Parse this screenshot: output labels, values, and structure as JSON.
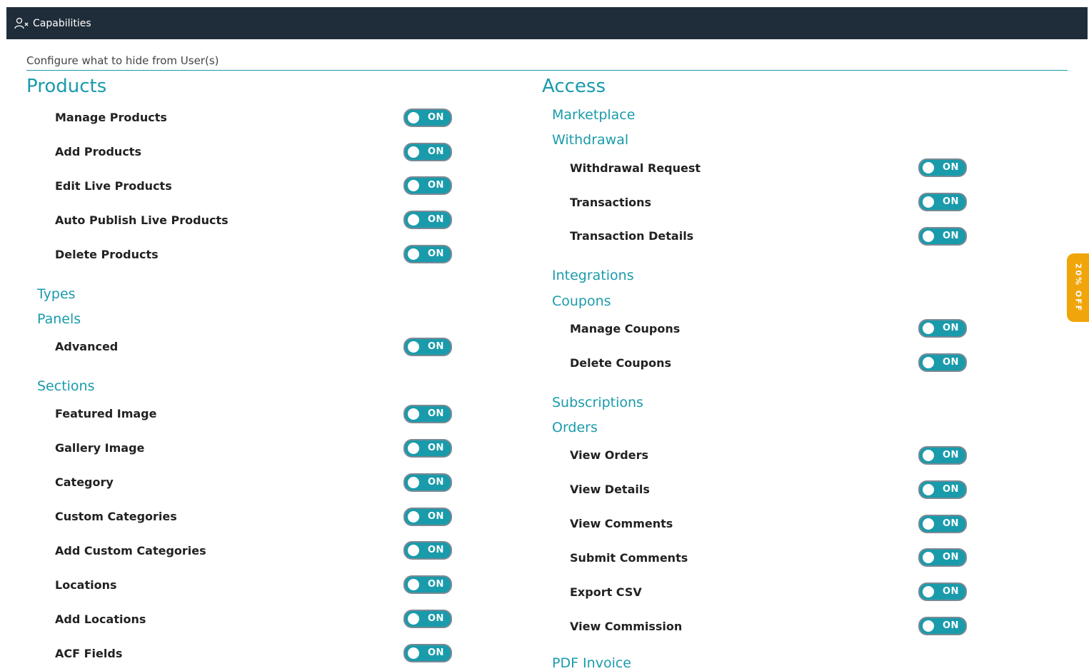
{
  "header": {
    "title": "Capabilities",
    "icon": "user-x-icon"
  },
  "subtitle": "Configure what to hide from User(s)",
  "toggle_label": "ON",
  "promo": "20% OFF",
  "left": {
    "title": "Products",
    "products": [
      "Manage Products",
      "Add Products",
      "Edit Live Products",
      "Auto Publish Live Products",
      "Delete Products"
    ],
    "types": "Types",
    "panels": "Panels",
    "panels_items": [
      "Advanced"
    ],
    "sections": "Sections",
    "sections_items": [
      "Featured Image",
      "Gallery Image",
      "Category",
      "Custom Categories",
      "Add Custom Categories",
      "Locations",
      "Add Locations",
      "ACF Fields"
    ]
  },
  "right": {
    "title": "Access",
    "marketplace": "Marketplace",
    "withdrawal": "Withdrawal",
    "withdrawal_items": [
      "Withdrawal Request",
      "Transactions",
      "Transaction Details"
    ],
    "integrations": "Integrations",
    "coupons": "Coupons",
    "coupons_items": [
      "Manage Coupons",
      "Delete Coupons"
    ],
    "subscriptions": "Subscriptions",
    "orders": "Orders",
    "orders_items": [
      "View Orders",
      "View Details",
      "View Comments",
      "Submit Comments",
      "Export CSV",
      "View Commission"
    ],
    "pdf": "PDF Invoice"
  }
}
